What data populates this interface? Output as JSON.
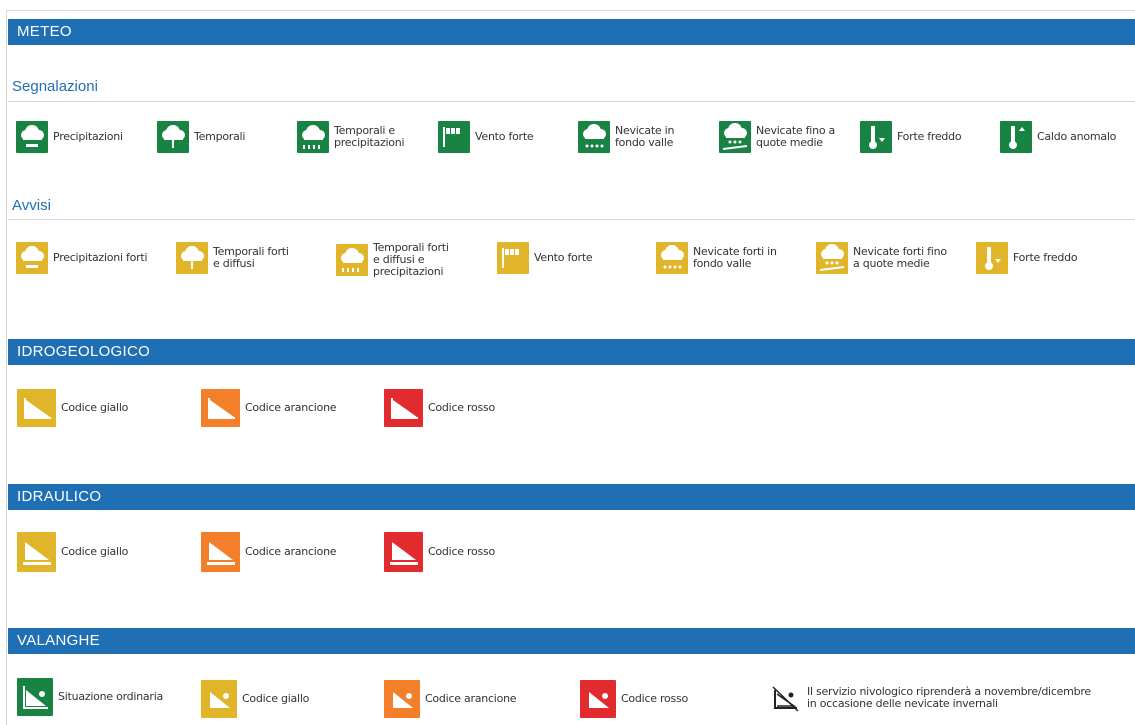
{
  "sections": {
    "meteo": "METEO",
    "idrogeologico": "IDROGEOLOGICO",
    "idraulico": "IDRAULICO",
    "valanghe": "VALANGHE"
  },
  "subsections": {
    "segnalazioni": "Segnalazioni",
    "avvisi": "Avvisi"
  },
  "segnalazioni": [
    {
      "label": "Precipitazioni",
      "icon": "cloud-rain-icon"
    },
    {
      "label": "Temporali",
      "icon": "thunderstorm-icon"
    },
    {
      "label": "Temporali e\nprecipitazioni",
      "icon": "thunderstorm-rain-icon"
    },
    {
      "label": "Vento forte",
      "icon": "wind-flag-icon"
    },
    {
      "label": "Nevicate in\nfondo valle",
      "icon": "snow-valley-icon"
    },
    {
      "label": "Nevicate fino a\nquote medie",
      "icon": "snow-mid-altitude-icon"
    },
    {
      "label": "Forte freddo",
      "icon": "cold-thermometer-icon"
    },
    {
      "label": "Caldo anomalo",
      "icon": "heat-thermometer-icon"
    }
  ],
  "avvisi": [
    {
      "label": "Precipitazioni forti",
      "icon": "cloud-rain-icon"
    },
    {
      "label": "Temporali forti\ne diffusi",
      "icon": "thunderstorm-icon"
    },
    {
      "label": "Temporali forti\ne diffusi e\nprecipitazioni",
      "icon": "thunderstorm-rain-icon"
    },
    {
      "label": "Vento forte",
      "icon": "wind-flag-icon"
    },
    {
      "label": "Nevicate forti in\nfondo valle",
      "icon": "snow-valley-icon"
    },
    {
      "label": "Nevicate forti fino\na quote medie",
      "icon": "snow-mid-altitude-icon"
    },
    {
      "label": "Forte freddo",
      "icon": "cold-thermometer-icon"
    }
  ],
  "idrogeologico": [
    {
      "label": "Codice giallo",
      "icon": "landslide-icon"
    },
    {
      "label": "Codice arancione",
      "icon": "landslide-icon"
    },
    {
      "label": "Codice rosso",
      "icon": "landslide-icon"
    }
  ],
  "idraulico": [
    {
      "label": "Codice giallo",
      "icon": "flood-icon"
    },
    {
      "label": "Codice arancione",
      "icon": "flood-icon"
    },
    {
      "label": "Codice rosso",
      "icon": "flood-icon"
    }
  ],
  "valanghe": [
    {
      "label": "Situazione ordinaria",
      "icon": "avalanche-icon"
    },
    {
      "label": "Codice giallo",
      "icon": "avalanche-icon"
    },
    {
      "label": "Codice arancione",
      "icon": "avalanche-icon"
    },
    {
      "label": "Codice rosso",
      "icon": "avalanche-icon"
    },
    {
      "label": "Il servizio nivologico riprenderà a novembre/dicembre\nin occasione delle nevicate invernali",
      "icon": "service-paused-icon"
    }
  ],
  "colors": {
    "header_blue": "#1f6fb4",
    "green": "#188343",
    "yellow": "#e0b52a",
    "orange": "#f47f2b",
    "red": "#e22b2f"
  }
}
